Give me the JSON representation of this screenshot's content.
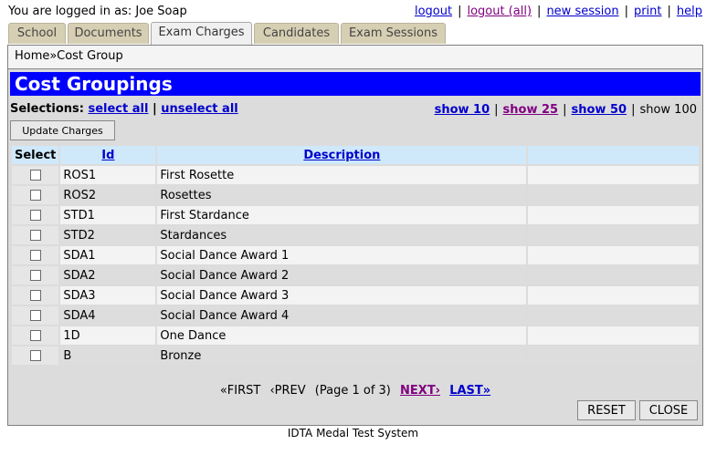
{
  "user": {
    "prefix": "You are logged in as:",
    "name": "Joe Soap"
  },
  "top_links": [
    {
      "label": "logout"
    },
    {
      "label": "logout (all)"
    },
    {
      "label": "new session"
    },
    {
      "label": "print"
    },
    {
      "label": "help"
    }
  ],
  "tabs": [
    {
      "label": "School"
    },
    {
      "label": "Documents"
    },
    {
      "label": "Exam Charges",
      "active": true
    },
    {
      "label": "Candidates"
    },
    {
      "label": "Exam Sessions"
    }
  ],
  "breadcrumb": "Home»Cost Group",
  "page_title": "Cost Groupings",
  "selections": {
    "label": "Selections:",
    "select_all": "select all",
    "unselect_all": "unselect all",
    "separator": "|"
  },
  "show": {
    "show10": "show 10",
    "show25": "show 25",
    "show50": "show 50",
    "show100": "show 100"
  },
  "update_button": "Update Charges",
  "table": {
    "headers": {
      "select": "Select",
      "id": "Id",
      "description": "Description"
    },
    "rows": [
      {
        "id": "ROS1",
        "description": "First Rosette"
      },
      {
        "id": "ROS2",
        "description": "Rosettes"
      },
      {
        "id": "STD1",
        "description": "First Stardance"
      },
      {
        "id": "STD2",
        "description": "Stardances"
      },
      {
        "id": "SDA1",
        "description": "Social Dance Award 1"
      },
      {
        "id": "SDA2",
        "description": "Social Dance Award 2"
      },
      {
        "id": "SDA3",
        "description": "Social Dance Award 3"
      },
      {
        "id": "SDA4",
        "description": "Social Dance Award 4"
      },
      {
        "id": "1D",
        "description": "One Dance"
      },
      {
        "id": "B",
        "description": "Bronze"
      }
    ]
  },
  "pager": {
    "first": "«FIRST",
    "prev": "‹PREV",
    "status": "(Page 1 of 3)",
    "next": "NEXT›",
    "last": "LAST»"
  },
  "buttons": {
    "reset": "RESET",
    "close": "CLOSE"
  },
  "footer": "IDTA Medal Test System",
  "colors": {
    "title_bar": "#0000ff",
    "header_bg": "#cfe9fb",
    "tab_bg": "#d7cfb3"
  }
}
